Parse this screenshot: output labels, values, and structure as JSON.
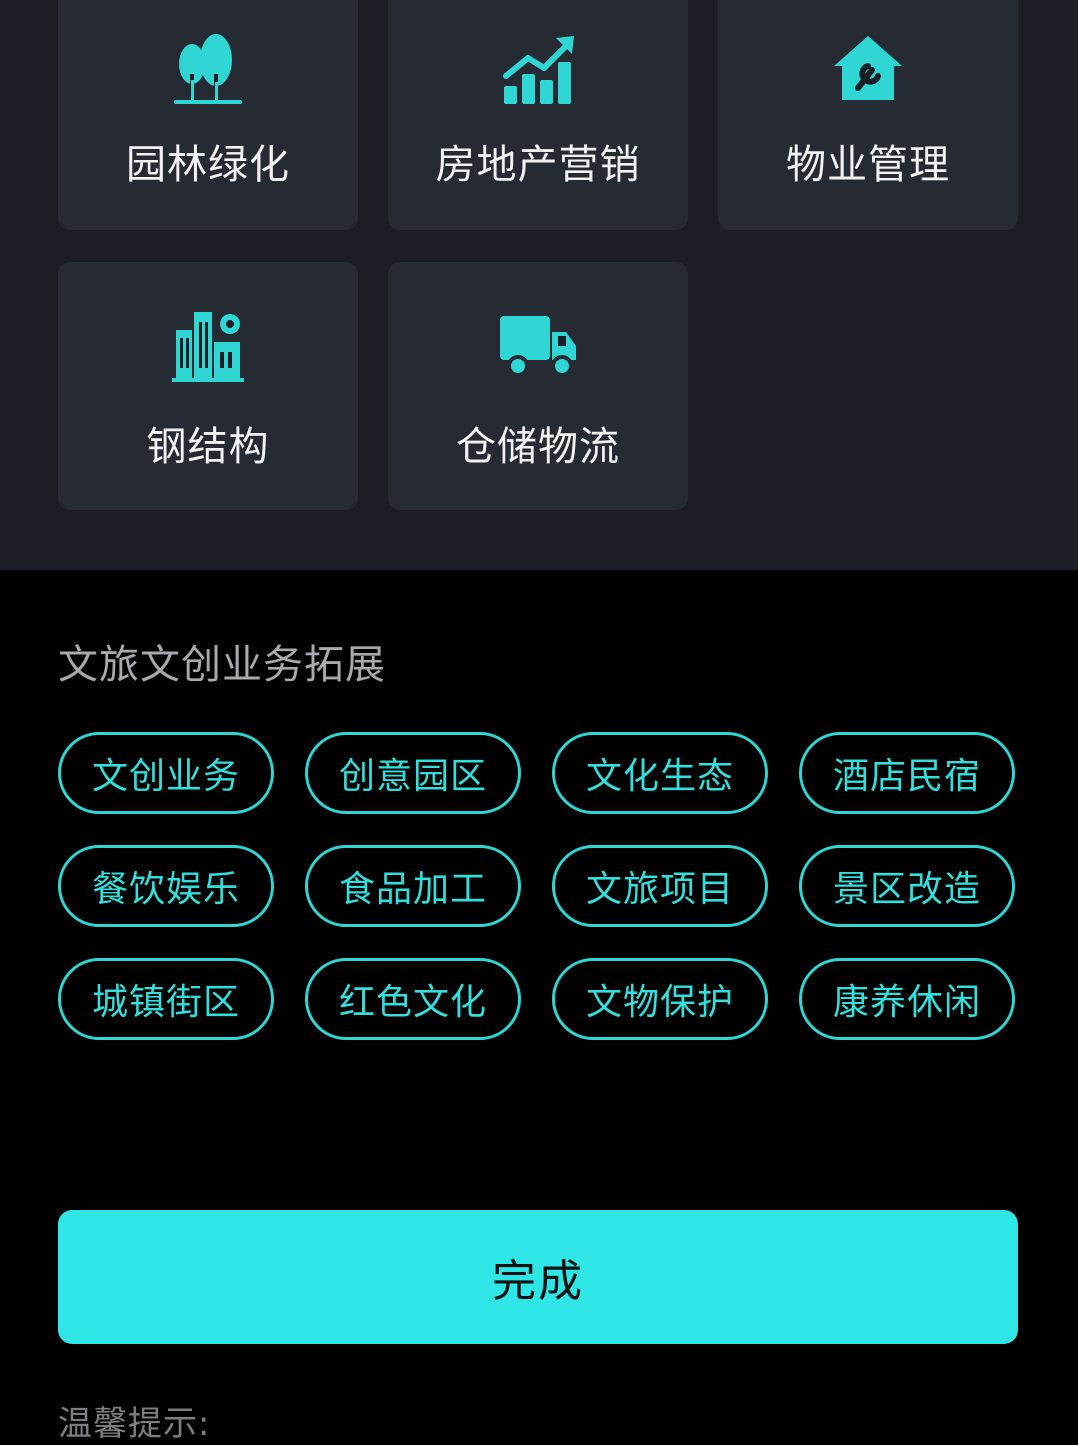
{
  "accent_color": "#2fd6d3",
  "cards": [
    {
      "label": "园林绿化",
      "icon": "trees-icon"
    },
    {
      "label": "房地产营销",
      "icon": "growth-chart-icon"
    },
    {
      "label": "物业管理",
      "icon": "house-repair-icon"
    },
    {
      "label": "钢结构",
      "icon": "building-gear-icon"
    },
    {
      "label": "仓储物流",
      "icon": "truck-icon"
    }
  ],
  "section": {
    "title": "文旅文创业务拓展",
    "tags": [
      "文创业务",
      "创意园区",
      "文化生态",
      "酒店民宿",
      "餐饮娱乐",
      "食品加工",
      "文旅项目",
      "景区改造",
      "城镇街区",
      "红色文化",
      "文物保护",
      "康养休闲"
    ]
  },
  "done_label": "完成",
  "tip_label": "温馨提示:"
}
